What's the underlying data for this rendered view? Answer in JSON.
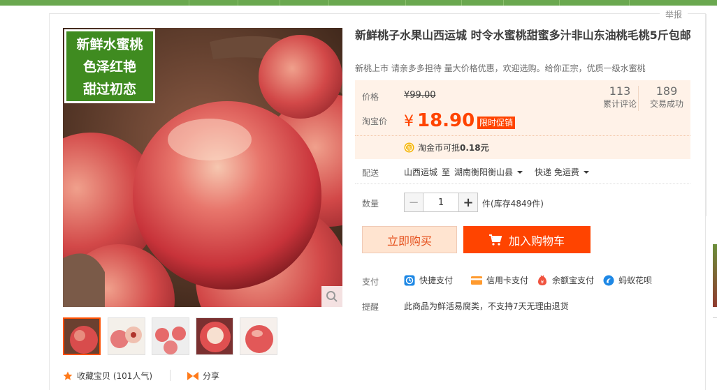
{
  "report_label": "举报",
  "promo_overlay": {
    "line1": "新鲜水蜜桃",
    "line2": "色泽红艳",
    "line3": "甜过初恋"
  },
  "product": {
    "title": "新鲜桃子水果山西运城 时令水蜜桃甜蜜多汁非山东油桃毛桃5斤包邮",
    "subtitle": "新桃上市 请亲多多担待 量大价格优惠，欢迎选购。给你正宗，优质一级水蜜桃"
  },
  "price": {
    "label": "价格",
    "original": "¥99.00",
    "taobao_label": "淘宝价",
    "currency": "¥",
    "current": "18.90",
    "promo_tag": "限时促销"
  },
  "stats": [
    {
      "value": "113",
      "label": "累计评论"
    },
    {
      "value": "189",
      "label": "交易成功"
    }
  ],
  "coin": {
    "text_prefix": "淘金币可抵",
    "amount": "0.18元"
  },
  "shipping": {
    "label": "配送",
    "from": "山西运城",
    "to_word": "至",
    "to": "湖南衡阳衡山县",
    "courier": "快递 免运费"
  },
  "quantity": {
    "label": "数量",
    "minus": "−",
    "value": "1",
    "plus": "+",
    "stock": "件(库存4849件)"
  },
  "buttons": {
    "buy_now": "立即购买",
    "add_cart": "加入购物车"
  },
  "payment": {
    "label": "支付",
    "methods": [
      "快捷支付",
      "信用卡支付",
      "余额宝支付",
      "蚂蚁花呗"
    ]
  },
  "notice": {
    "label": "提醒",
    "text": "此商品为鲜活易腐类，不支持7天无理由退货"
  },
  "actions": {
    "favorite": "收藏宝贝 (101人气)",
    "share": "分享"
  },
  "colors": {
    "accent": "#ff4400",
    "top_bar": "#6aa84f",
    "price_bg": "#fff2e8"
  }
}
